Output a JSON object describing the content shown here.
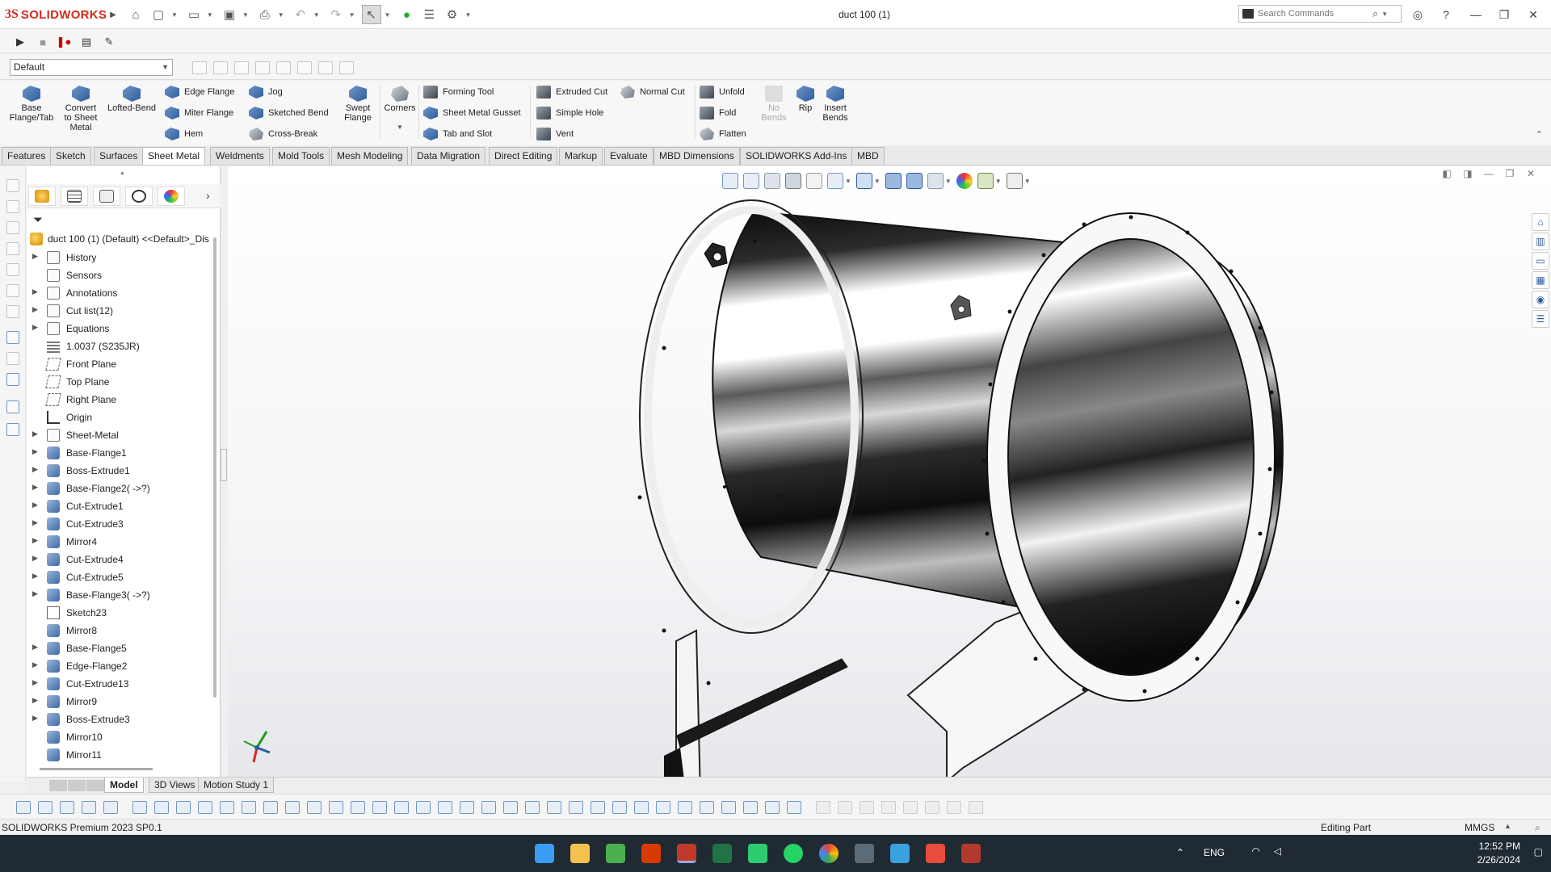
{
  "app": {
    "brand": "SOLIDWORKS",
    "document_title": "duct 100 (1)"
  },
  "search": {
    "placeholder": "Search Commands"
  },
  "config": {
    "selected": "Default"
  },
  "command_manager": {
    "big_buttons": [
      {
        "id": "base-flange",
        "label": "Base\nFlange/Tab"
      },
      {
        "id": "convert",
        "label": "Convert\nto Sheet\nMetal"
      },
      {
        "id": "lofted-bend",
        "label": "Lofted-Bend"
      },
      {
        "id": "swept-flange",
        "label": "Swept\nFlange"
      },
      {
        "id": "corners",
        "label": "Corners"
      },
      {
        "id": "no-bends",
        "label": "No\nBends"
      },
      {
        "id": "rip",
        "label": "Rip"
      },
      {
        "id": "insert-bends",
        "label": "Insert\nBends"
      }
    ],
    "col1": [
      "Edge Flange",
      "Miter Flange",
      "Hem"
    ],
    "col2": [
      "Jog",
      "Sketched Bend",
      "Cross-Break"
    ],
    "col3": [
      "Forming Tool",
      "Sheet Metal Gusset",
      "Tab and Slot"
    ],
    "col4": [
      "Extruded Cut",
      "Simple Hole",
      "Vent"
    ],
    "col5": [
      "Normal Cut"
    ],
    "col6": [
      "Unfold",
      "Fold",
      "Flatten"
    ]
  },
  "tabs": [
    "Features",
    "Sketch",
    "Surfaces",
    "Sheet Metal",
    "Weldments",
    "Mold Tools",
    "Mesh Modeling",
    "Data Migration",
    "Direct Editing",
    "Markup",
    "Evaluate",
    "MBD Dimensions",
    "SOLIDWORKS Add-Ins",
    "MBD"
  ],
  "active_tab": "Sheet Metal",
  "feature_tree": {
    "root": "duct 100 (1) (Default) <<Default>_Dis",
    "items": [
      {
        "label": "History",
        "icon": "folder",
        "exp": true
      },
      {
        "label": "Sensors",
        "icon": "folder",
        "exp": false
      },
      {
        "label": "Annotations",
        "icon": "folder",
        "exp": true
      },
      {
        "label": "Cut list(12)",
        "icon": "folder",
        "exp": true
      },
      {
        "label": "Equations",
        "icon": "folder",
        "exp": true
      },
      {
        "label": "1.0037 (S235JR)",
        "icon": "material",
        "exp": false
      },
      {
        "label": "Front Plane",
        "icon": "plane",
        "exp": false
      },
      {
        "label": "Top Plane",
        "icon": "plane",
        "exp": false
      },
      {
        "label": "Right Plane",
        "icon": "plane",
        "exp": false
      },
      {
        "label": "Origin",
        "icon": "origin",
        "exp": false
      },
      {
        "label": "Sheet-Metal",
        "icon": "folder",
        "exp": true
      },
      {
        "label": "Base-Flange1",
        "icon": "feature",
        "exp": true
      },
      {
        "label": "Boss-Extrude1",
        "icon": "feature",
        "exp": true
      },
      {
        "label": "Base-Flange2( ->?)",
        "icon": "feature",
        "exp": true
      },
      {
        "label": "Cut-Extrude1",
        "icon": "feature",
        "exp": true
      },
      {
        "label": "Cut-Extrude3",
        "icon": "feature",
        "exp": true
      },
      {
        "label": "Mirror4",
        "icon": "feature",
        "exp": true
      },
      {
        "label": "Cut-Extrude4",
        "icon": "feature",
        "exp": true
      },
      {
        "label": "Cut-Extrude5",
        "icon": "feature",
        "exp": true
      },
      {
        "label": "Base-Flange3( ->?)",
        "icon": "feature",
        "exp": true
      },
      {
        "label": "Sketch23",
        "icon": "sketch",
        "exp": false
      },
      {
        "label": "Mirror8",
        "icon": "feature",
        "exp": false
      },
      {
        "label": "Base-Flange5",
        "icon": "feature",
        "exp": true
      },
      {
        "label": "Edge-Flange2",
        "icon": "feature",
        "exp": true
      },
      {
        "label": "Cut-Extrude13",
        "icon": "feature",
        "exp": true
      },
      {
        "label": "Mirror9",
        "icon": "feature",
        "exp": true
      },
      {
        "label": "Boss-Extrude3",
        "icon": "feature",
        "exp": true
      },
      {
        "label": "Mirror10",
        "icon": "feature",
        "exp": false
      },
      {
        "label": "Mirror11",
        "icon": "feature",
        "exp": false
      }
    ]
  },
  "model_tabs": [
    "Model",
    "3D Views",
    "Motion Study 1"
  ],
  "status": {
    "product": "SOLIDWORKS Premium 2023 SP0.1",
    "mode": "Editing Part",
    "units": "MMGS"
  },
  "taskbar": {
    "lang": "ENG",
    "time": "12:52 PM",
    "date": "2/26/2024"
  }
}
